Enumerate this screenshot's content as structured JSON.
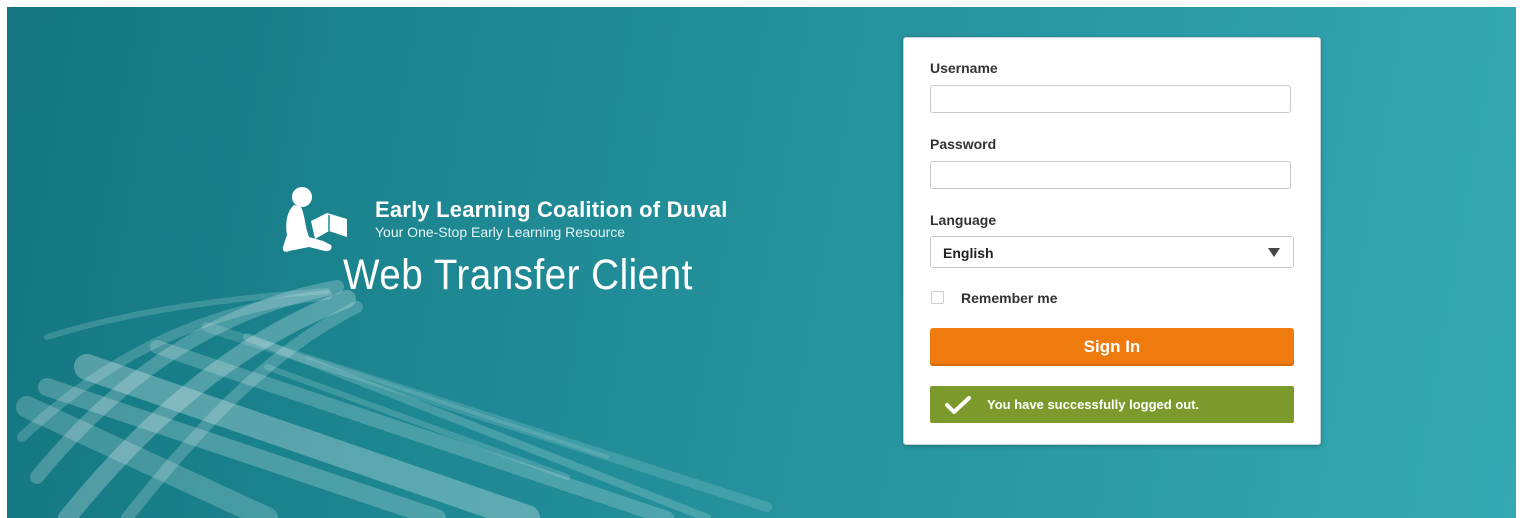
{
  "brand": {
    "organization": "Early Learning Coalition of Duval",
    "tagline": "Your One-Stop Early Learning Resource",
    "app_title": "Web Transfer Client"
  },
  "login": {
    "username_label": "Username",
    "username_value": "",
    "password_label": "Password",
    "password_value": "",
    "language_label": "Language",
    "language_selected": "English",
    "remember_label": "Remember me",
    "remember_checked": false,
    "signin_label": "Sign In",
    "status_message": "You have successfully logged out."
  },
  "icons": {
    "logo": "child-reading-book-icon",
    "dropdown": "caret-down-icon",
    "status": "checkmark-icon"
  },
  "colors": {
    "background": "#1d8792",
    "signin_button": "#ef7b0f",
    "success_alert": "#7c9a2b"
  }
}
